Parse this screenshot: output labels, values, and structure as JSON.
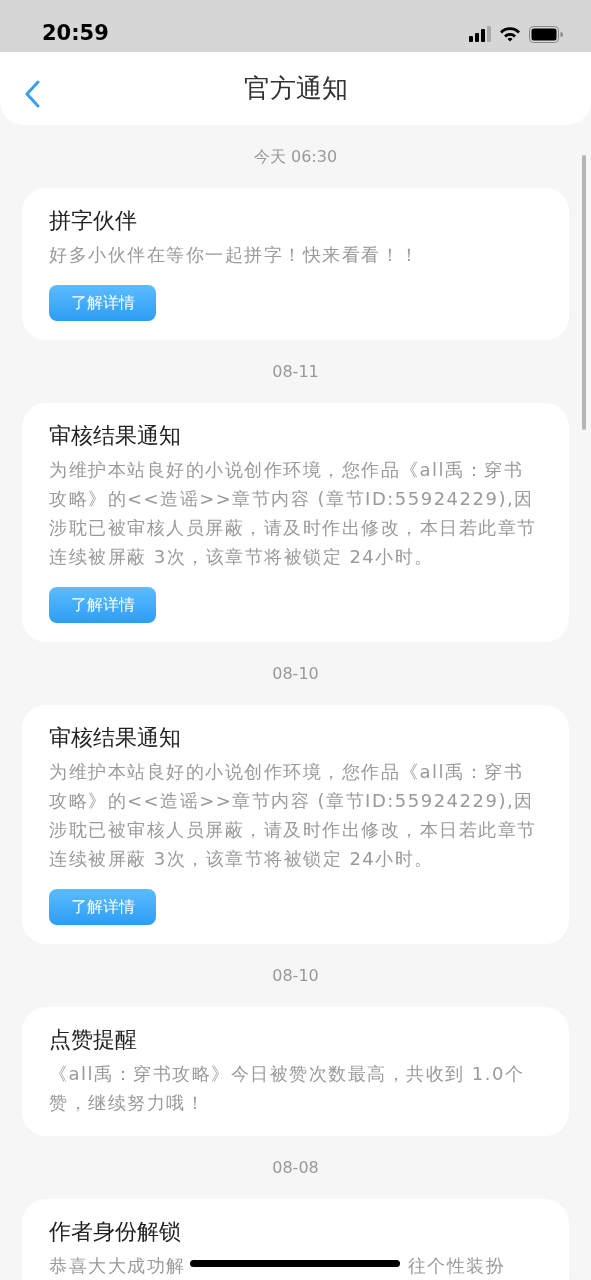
{
  "status_bar": {
    "time": "20:59"
  },
  "header": {
    "title": "官方通知"
  },
  "notifications": [
    {
      "date": "今天 06:30",
      "title": "拼字伙伴",
      "body": "好多小伙伴在等你一起拼字！快来看看！！",
      "button": "了解详情"
    },
    {
      "date": "08-11",
      "title": "审核结果通知",
      "body": "为维护本站良好的小说创作环境，您作品《all禹：穿书攻略》的<<造谣>>章节内容 (章节ID:55924229),因涉耽已被审核人员屏蔽，请及时作出修改，本日若此章节连续被屏蔽 3次，该章节将被锁定 24小时。",
      "button": "了解详情"
    },
    {
      "date": "08-10",
      "title": "审核结果通知",
      "body": "为维护本站良好的小说创作环境，您作品《all禹：穿书攻略》的<<造谣>>章节内容 (章节ID:55924229),因涉耽已被审核人员屏蔽，请及时作出修改，本日若此章节连续被屏蔽 3次，该章节将被锁定 24小时。",
      "button": "了解详情"
    },
    {
      "date": "08-10",
      "title": "点赞提醒",
      "body": "《all禹：穿书攻略》今日被赞次数最高，共收到 1.0个赞，继续努力哦！"
    },
    {
      "date": "08-08",
      "title": "作者身份解锁",
      "body_parts": [
        "恭喜大大成功解",
        "往个性装扮"
      ]
    }
  ]
}
